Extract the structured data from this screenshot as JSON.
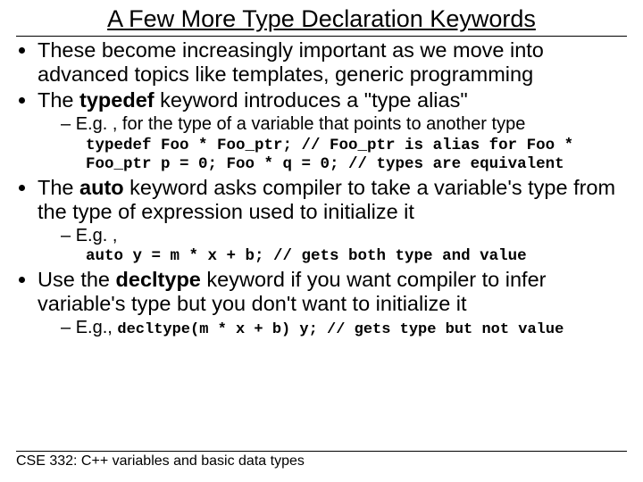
{
  "title": "A Few More Type Declaration Keywords",
  "b1": "These become increasingly important as we move into advanced topics like templates, generic programming",
  "b2_pre": "The ",
  "b2_kw": "typedef",
  "b2_post": " keyword introduces a \"type alias\"",
  "b2_sub": "E.g. , for the type of a variable that points to another type",
  "b2_code1": "typedef Foo * Foo_ptr; // Foo_ptr is alias for Foo *",
  "b2_code2": "Foo_ptr p = 0; Foo * q = 0; // types are equivalent",
  "b3_pre": "The ",
  "b3_kw": "auto",
  "b3_post": " keyword asks compiler to take a variable's type from the type of expression used to initialize it",
  "b3_sub": "E.g. ,",
  "b3_code": "auto y = m * x + b; // gets both type and value",
  "b4_pre": "Use the ",
  "b4_kw": "decltype",
  "b4_post": " keyword if you want compiler to infer variable's type but you don't want to initialize it",
  "b4_sub_pre": "E.g., ",
  "b4_sub_code": "decltype(m * x + b) y; // gets type but not value",
  "footer": "CSE 332: C++ variables and basic data types"
}
